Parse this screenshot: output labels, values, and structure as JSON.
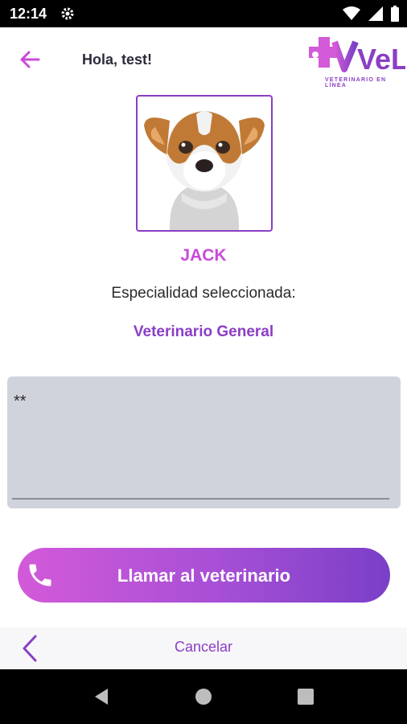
{
  "status_bar": {
    "time": "12:14"
  },
  "header": {
    "greeting": "Hola, test!",
    "logo_text": "VeL",
    "logo_subtitle": "VETERINARIO EN LÍNEA"
  },
  "pet": {
    "name": "JACK"
  },
  "specialty": {
    "label": "Especialidad seleccionada:",
    "value": "Veterinario General"
  },
  "message": {
    "value": "**"
  },
  "actions": {
    "call_label": "Llamar al veterinario",
    "cancel_label": "Cancelar"
  },
  "colors": {
    "accent": "#8b3ec5",
    "pink": "#c94ad9"
  }
}
